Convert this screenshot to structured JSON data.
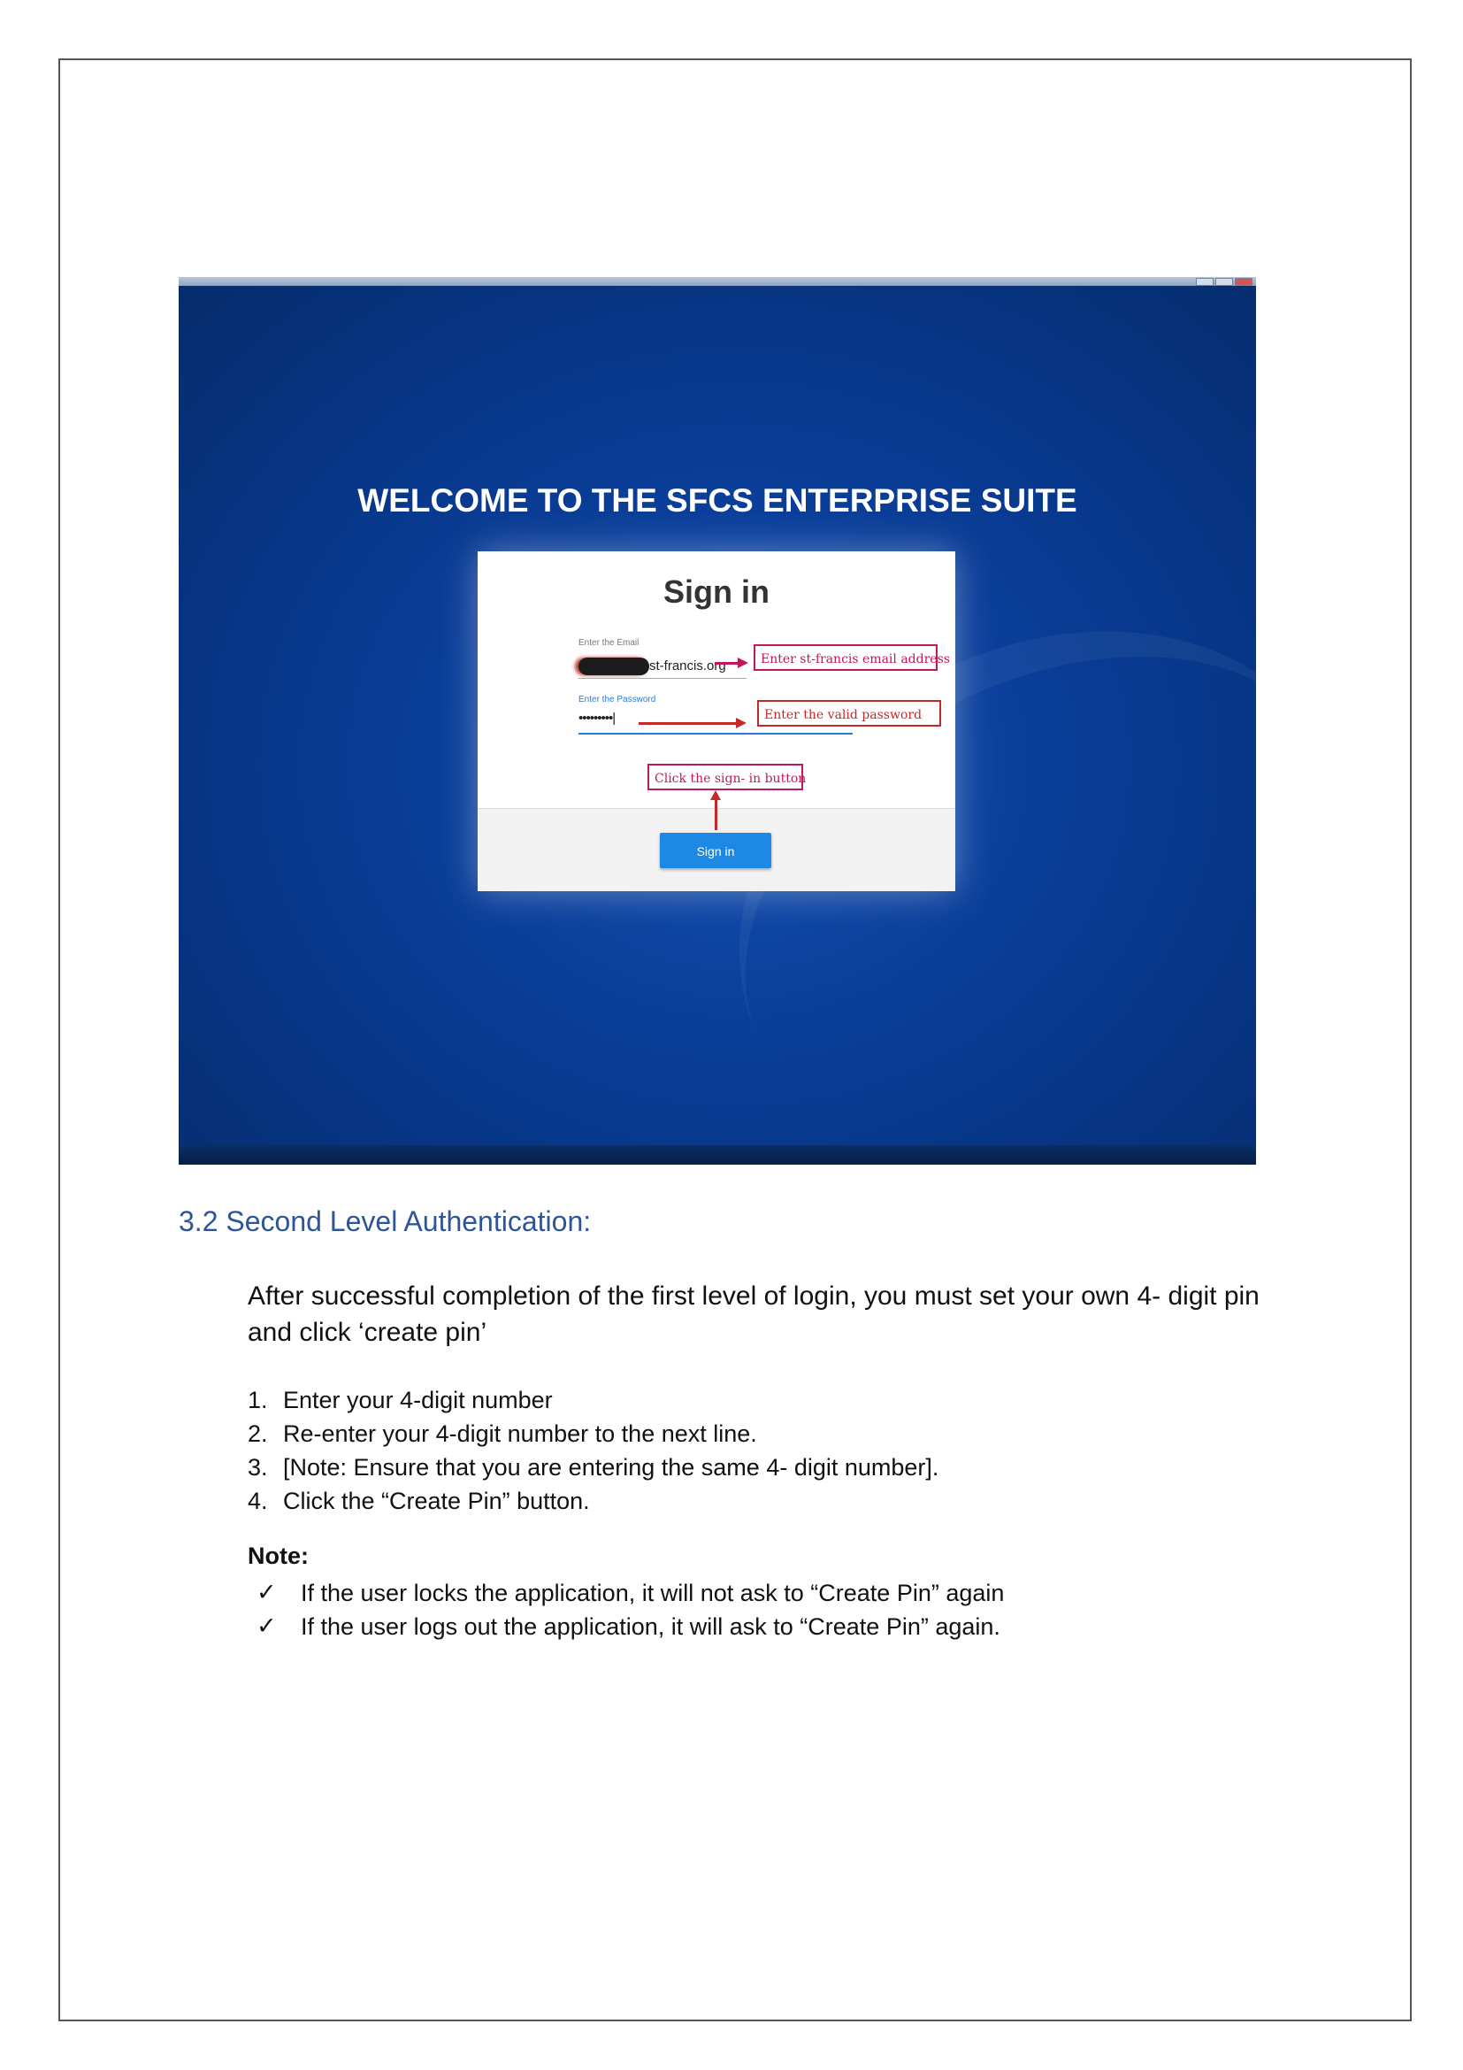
{
  "screenshot": {
    "welcome_heading": "WELCOME TO THE SFCS ENTERPRISE SUITE",
    "card": {
      "title": "Sign in",
      "email_caption": "Enter the Email",
      "email_value_suffix": "st-francis.org",
      "password_caption": "Enter the Password",
      "password_value": "•••••••••|",
      "signin_button": "Sign in"
    },
    "annotations": {
      "email": "Enter st-francis email address",
      "password": "Enter the valid password",
      "signin": "Click the sign- in button"
    }
  },
  "section": {
    "heading": "3.2 Second Level Authentication:",
    "intro": "After successful completion of the first level of login, you must set your own 4- digit pin and click ‘create pin’",
    "steps": [
      {
        "num": "1.",
        "text": "Enter your 4-digit number"
      },
      {
        "num": "2.",
        "text": "Re-enter your 4-digit number to the next line."
      },
      {
        "num": "3.",
        "text": "[Note: Ensure that you are entering the same 4- digit number]."
      },
      {
        "num": "4.",
        "text": "Click the “Create Pin” button."
      }
    ],
    "note_title": "Note:",
    "notes": [
      {
        "mark": "✓",
        "text": "If the user locks the application, it will not ask to “Create Pin” again"
      },
      {
        "mark": "✓",
        "text": "If the user logs out the application, it will ask to “Create Pin” again."
      }
    ]
  }
}
